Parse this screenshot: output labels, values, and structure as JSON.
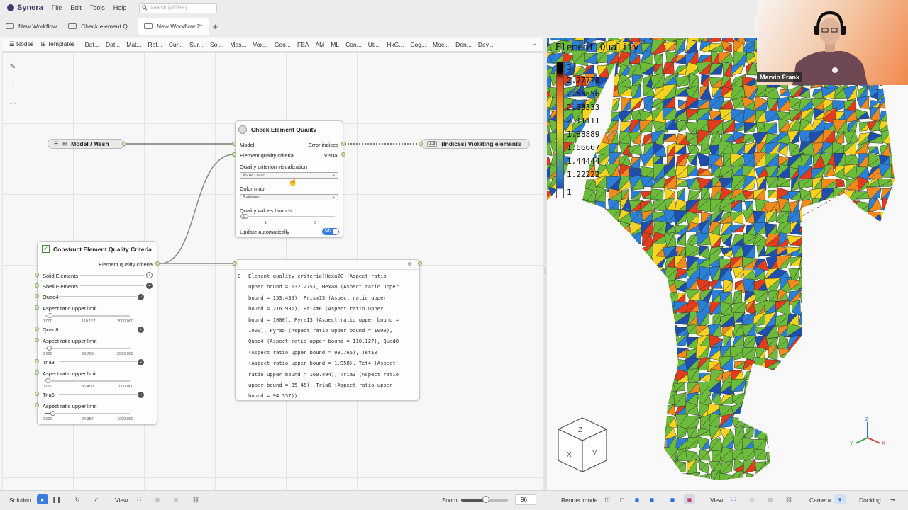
{
  "app": {
    "name": "Synera"
  },
  "menu": [
    "File",
    "Edit",
    "Tools",
    "Help"
  ],
  "search": {
    "placeholder": "Search (Shift+F)"
  },
  "tabs": [
    {
      "label": "New Workflow"
    },
    {
      "label": "Check element Q..."
    },
    {
      "label": "New Workflow 2*",
      "active": true
    }
  ],
  "toolbar": {
    "nodes_label": "Nodes",
    "templates_label": "Templates",
    "categories": [
      "Dat...",
      "Dat...",
      "Mat...",
      "Ref...",
      "Cur...",
      "Sur...",
      "Sol...",
      "Mes...",
      "Vox...",
      "Geo...",
      "FEA",
      "AM",
      "ML",
      "Con...",
      "Uti...",
      "HxG...",
      "Cog...",
      "Moc...",
      "Den...",
      "Dev..."
    ]
  },
  "nodes": {
    "model_mesh": {
      "title": "Model / Mesh"
    },
    "violating": {
      "title": "(Indices) Violating elements",
      "badge": "1.8"
    },
    "check": {
      "title": "Check Element Quality",
      "input_model": "Model",
      "input_criteria": "Element quality criteria",
      "output_errors": "Error indices",
      "output_visual": "Visual",
      "viz_label": "Quality criterion visualization",
      "viz_value": "Aspect ratio",
      "colormap_label": "Color map",
      "colormap_value": "Rainbow",
      "bounds_label": "Quality values bounds",
      "bounds_min": "1",
      "bounds_max": "3",
      "update_label": "Update automatically",
      "update_toggle": "ON"
    },
    "construct": {
      "title": "Construct Element Quality Criteria",
      "output": "Element quality criteria",
      "rows": [
        {
          "label": "Solid Elements",
          "kind": "expander"
        },
        {
          "label": "Shell Elements",
          "kind": "collapser"
        },
        {
          "label": "Quad4",
          "kind": "collapser"
        },
        {
          "label": "Aspect ratio upper limit",
          "min": "0.000",
          "value": "110.127",
          "max": "2000.000",
          "level": 0.055
        },
        {
          "label": "Quad8",
          "kind": "collapser"
        },
        {
          "label": "Aspect ratio upper limit",
          "min": "0.000",
          "value": "98.765",
          "max": "2000.000",
          "level": 0.049
        },
        {
          "label": "Tria3",
          "kind": "collapser"
        },
        {
          "label": "Aspect ratio upper limit",
          "min": "0.000",
          "value": "35.450",
          "max": "1000.000",
          "level": 0.035
        },
        {
          "label": "Tria6",
          "kind": "collapser"
        },
        {
          "label": "Aspect ratio upper limit",
          "min": "0.000",
          "value": "94.357",
          "max": "1000.000",
          "level": 0.094
        }
      ]
    },
    "output_panel": {
      "header_count": "0",
      "index": "0",
      "lines": [
        "Element quality criteria(Hexa20 (Aspect ratio",
        "upper bound = 132.275), Hexa8 (Aspect ratio upper",
        "bound = 153.439), Prism15 (Aspect ratio upper",
        "bound = 216.931), Prism6 (Aspect ratio upper",
        "bound = 1000), Pyra13 (Aspect ratio upper bound =",
        "1000), Pyra5 (Aspect ratio upper bound = 1000),",
        "Quad4 (Aspect ratio upper bound = 110.127), Quad8",
        "(Aspect ratio upper bound = 98.765), Tet10",
        "(Aspect ratio upper bound = 1.958), Tet4 (Aspect",
        "ratio upper bound = 160.494), Tria3 (Aspect ratio",
        "upper bound = 35.45), Tria6 (Aspect ratio upper",
        "bound = 94.357))"
      ]
    }
  },
  "viewport": {
    "colorbar_title": "Element Quality",
    "colorbar_labels": [
      "3",
      "2.77778",
      "2.55556",
      "2.33333",
      "2.11111",
      "1.88889",
      "1.66667",
      "1.44444",
      "1.22222",
      "1"
    ],
    "colors": {
      "red": "#e23b1e",
      "orange": "#f28b1c",
      "yellow": "#f5d31f",
      "green": "#6cbb3b",
      "blue": "#2a7fd8",
      "dark_blue": "#1f4db0"
    },
    "axis_labels": {
      "x": "X",
      "y": "Y",
      "z": "Z"
    }
  },
  "presenter": {
    "name": "Marvin Frank"
  },
  "bottombar": {
    "solution_label": "Solution",
    "view_label": "View",
    "zoom_label": "Zoom",
    "zoom_value": "96",
    "render_mode_label": "Render mode",
    "view_label_right": "View",
    "camera_label": "Camera",
    "docking_label": "Docking"
  }
}
